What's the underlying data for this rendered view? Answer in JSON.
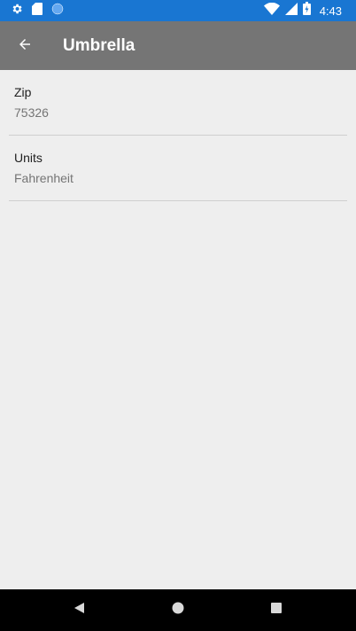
{
  "status_bar": {
    "time": "4:43",
    "color": "#1976d2",
    "left_icons": [
      "settings-icon",
      "sd-card-icon",
      "circle-icon"
    ],
    "right_icons": [
      "wifi-icon",
      "signal-icon",
      "battery-icon"
    ]
  },
  "app_bar": {
    "title": "Umbrella",
    "back_icon": "arrow-back-icon",
    "color": "#757575"
  },
  "preferences": [
    {
      "title": "Zip",
      "summary": "75326"
    },
    {
      "title": "Units",
      "summary": "Fahrenheit"
    }
  ],
  "nav_bar": {
    "buttons": [
      "back-triangle-icon",
      "home-circle-icon",
      "recents-square-icon"
    ]
  }
}
